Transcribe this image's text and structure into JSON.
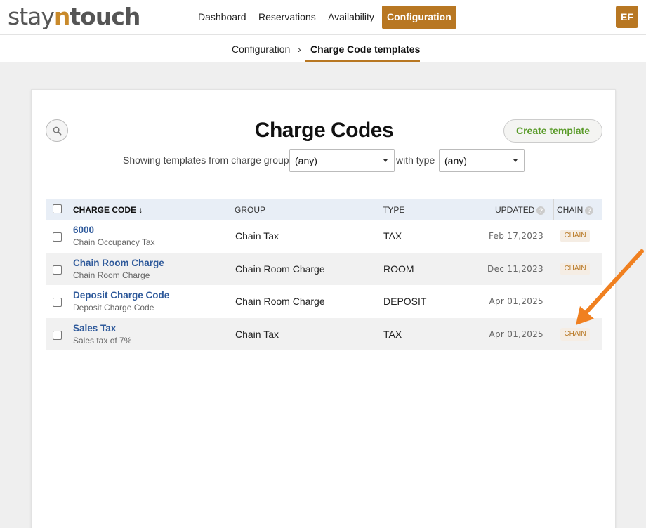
{
  "app": {
    "logo_prefix": "stay",
    "logo_n": "n",
    "logo_suffix": "touch"
  },
  "nav": {
    "items": [
      {
        "label": "Dashboard"
      },
      {
        "label": "Reservations"
      },
      {
        "label": "Availability"
      },
      {
        "label": "Configuration",
        "active": true
      }
    ],
    "avatar": "EF"
  },
  "breadcrumb": {
    "parent": "Configuration",
    "separator": "›",
    "current": "Charge Code templates"
  },
  "page": {
    "title": "Charge Codes",
    "create_button": "Create template",
    "filter_prefix": "Showing templates from charge group",
    "group_value": "(any)",
    "filter_middle": "with type",
    "type_value": "(any)"
  },
  "table": {
    "headers": {
      "code": "CHARGE CODE ↓",
      "group": "GROUP",
      "type": "TYPE",
      "updated": "UPDATED",
      "chain": "CHAIN",
      "help": "?"
    },
    "rows": [
      {
        "code": "6000",
        "description": "Chain Occupancy Tax",
        "group": "Chain Tax",
        "type": "TAX",
        "updated": "Feb 17,2023",
        "chain": "CHAIN"
      },
      {
        "code": "Chain Room Charge",
        "description": "Chain Room Charge",
        "group": "Chain Room Charge",
        "type": "ROOM",
        "updated": "Dec 11,2023",
        "chain": "CHAIN"
      },
      {
        "code": "Deposit Charge Code",
        "description": "Deposit Charge Code",
        "group": "Chain Room Charge",
        "type": "DEPOSIT",
        "updated": "Apr 01,2025",
        "chain": ""
      },
      {
        "code": "Sales Tax",
        "description": "Sales tax of 7%",
        "group": "Chain Tax",
        "type": "TAX",
        "updated": "Apr 01,2025",
        "chain": "CHAIN"
      }
    ]
  },
  "colors": {
    "brand": "#b87722",
    "link": "#2f5a9b",
    "create": "#5a9b2a",
    "annotation_arrow": "#f08020"
  }
}
